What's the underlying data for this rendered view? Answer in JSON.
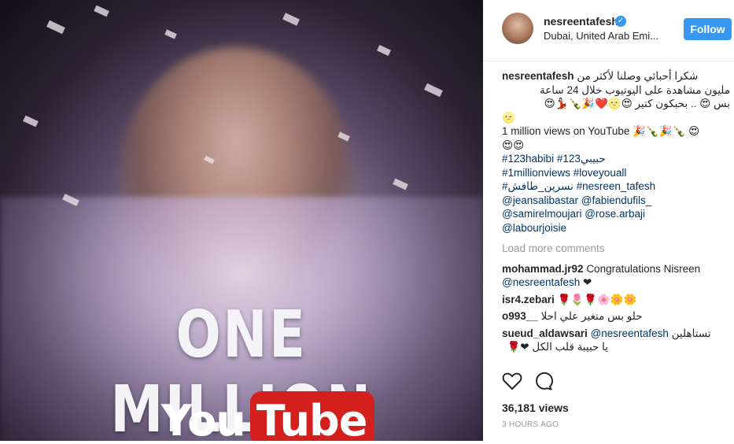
{
  "media": {
    "title_text": "ONE MILLION",
    "logo_you": "You",
    "logo_tube": "Tube"
  },
  "post": {
    "username": "nesreentafesh",
    "location": "Dubai, United Arab Emi...",
    "follow_label": "Follow"
  },
  "caption": {
    "username": "nesreentafesh",
    "line1": "شكرا أحبائي وصلنا لأكثر من",
    "line2": "مليون مشاهدة على اليوتيوب خلال 24 ساعة",
    "line3": "بس 😍 .. بحبكون كتير 😍🌝❤️🎉🍾💃🏻😍",
    "line4": "🌝",
    "line5": "1 million views on YouTube 🎉🍾🎉🍾 😍",
    "line6": "😍😍",
    "tags1": "#123habibi #حبيبي123",
    "tags2": "#1millionviews #loveyouall",
    "tags3": "#نسرين_طافش #nesreen_tafesh",
    "mentions1": "@jeansalibastar @fabiendufils_",
    "mentions2": "@samirelmoujari @rose.arbaji",
    "mentions3": "@labourjoisie"
  },
  "load_more": "Load more comments",
  "comments": [
    {
      "user": "mohammad.jr92",
      "text": "Congratulations Nisreen",
      "mention": "@nesreentafesh",
      "after": "❤"
    },
    {
      "user": "isr4.zebari",
      "text": "🌹🌷🌹🌸🌼🌼"
    },
    {
      "user": "o993__",
      "text": "حلو بس متغير علي احلا"
    },
    {
      "user": "sueud_aldawsari",
      "mention": "@nesreentafesh",
      "text": "تستاهلين",
      "line2": "يا حبيبة قلب الكل ❤🌹"
    }
  ],
  "stats": {
    "views": "36,181 views",
    "time": "3 HOURS AGO"
  },
  "colors": {
    "accent": "#3897f0",
    "link": "#003569",
    "muted": "#999999",
    "youtube_red": "#d4201d"
  },
  "icons": [
    "verified-badge-icon",
    "heart-icon",
    "comment-icon"
  ]
}
